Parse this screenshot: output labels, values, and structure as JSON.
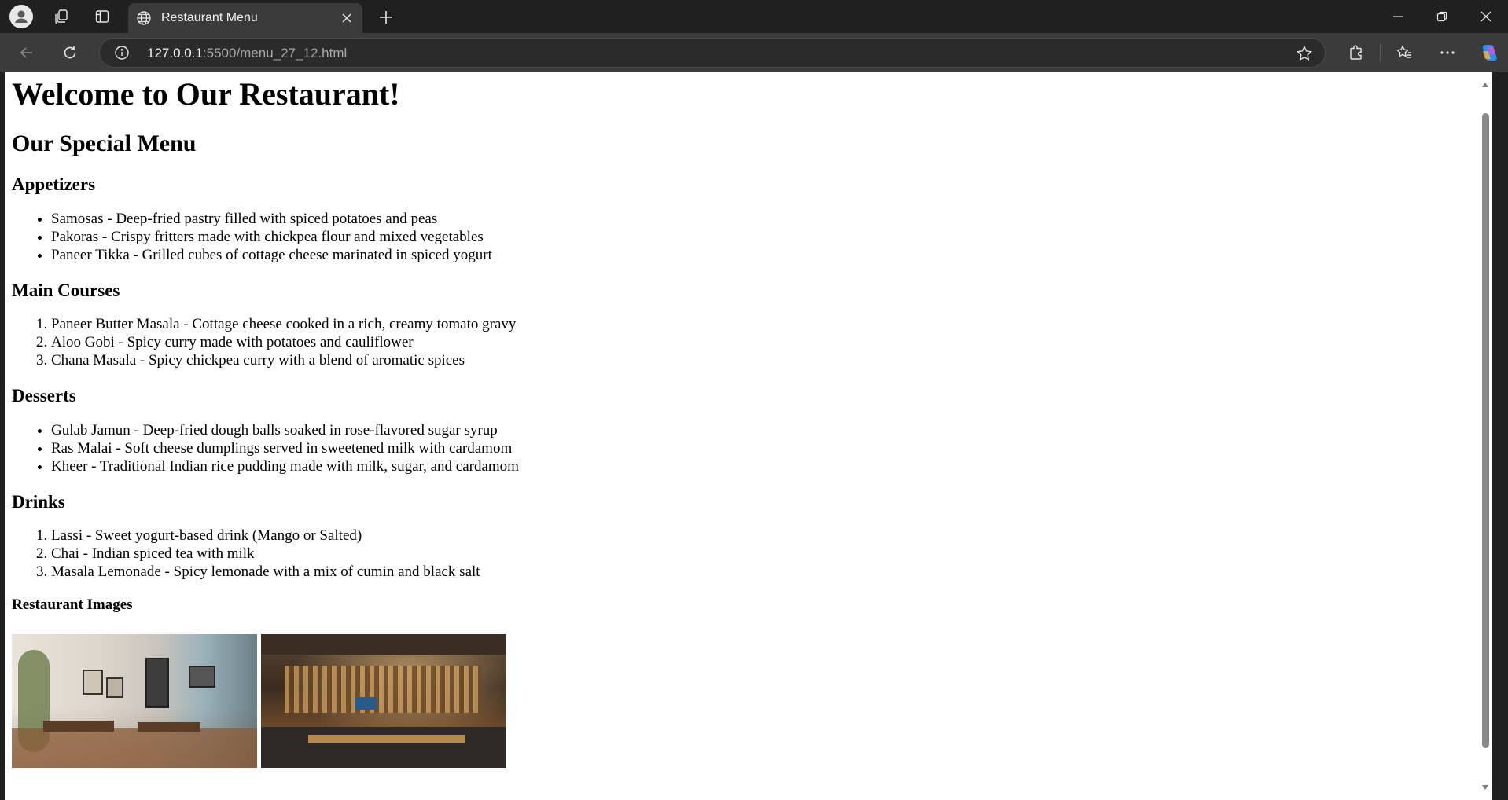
{
  "browser": {
    "tab": {
      "title": "Restaurant Menu"
    },
    "address": {
      "host": "127.0.0.1",
      "path": ":5500/menu_27_12.html"
    }
  },
  "page": {
    "heading": "Welcome to Our Restaurant!",
    "subheading": "Our Special Menu",
    "sections": {
      "appetizers": {
        "title": "Appetizers",
        "items": [
          "Samosas - Deep-fried pastry filled with spiced potatoes and peas",
          "Pakoras - Crispy fritters made with chickpea flour and mixed vegetables",
          "Paneer Tikka - Grilled cubes of cottage cheese marinated in spiced yogurt"
        ]
      },
      "main_courses": {
        "title": "Main Courses",
        "items": [
          "Paneer Butter Masala - Cottage cheese cooked in a rich, creamy tomato gravy",
          "Aloo Gobi - Spicy curry made with potatoes and cauliflower",
          "Chana Masala - Spicy chickpea curry with a blend of aromatic spices"
        ]
      },
      "desserts": {
        "title": "Desserts",
        "items": [
          "Gulab Jamun - Deep-fried dough balls soaked in rose-flavored sugar syrup",
          "Ras Malai - Soft cheese dumplings served in sweetened milk with cardamom",
          "Kheer - Traditional Indian rice pudding made with milk, sugar, and cardamom"
        ]
      },
      "drinks": {
        "title": "Drinks",
        "items": [
          "Lassi - Sweet yogurt-based drink (Mango or Salted)",
          "Chai - Indian spiced tea with milk",
          "Masala Lemonade - Spicy lemonade with a mix of cumin and black salt"
        ]
      }
    },
    "images_title": "Restaurant Images"
  },
  "colors": {
    "chrome_dark": "#202020",
    "chrome_toolbar": "#3b3b3b",
    "page_background": "#ffffff",
    "text": "#000000"
  },
  "icons": [
    "profile-icon",
    "workspaces-icon",
    "vertical-tabs-icon",
    "globe-icon",
    "close-icon",
    "new-tab-icon",
    "minimize-icon",
    "restore-icon",
    "window-close-icon",
    "back-icon",
    "refresh-icon",
    "info-icon",
    "favorite-star-icon",
    "extensions-icon",
    "favorites-icon",
    "more-icon",
    "copilot-icon"
  ]
}
